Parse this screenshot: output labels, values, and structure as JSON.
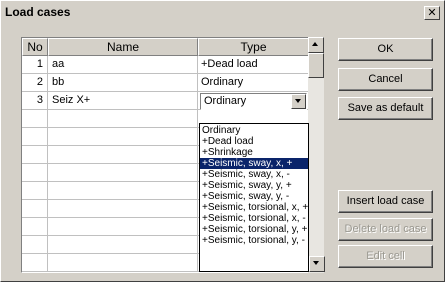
{
  "window": {
    "title": "Load cases",
    "close_glyph": "✕"
  },
  "grid": {
    "headers": {
      "no": "No",
      "name": "Name",
      "type": "Type"
    },
    "rows": [
      {
        "no": "1",
        "name": "aa",
        "type": "+Dead load"
      },
      {
        "no": "2",
        "name": "bb",
        "type": "Ordinary"
      },
      {
        "no": "3",
        "name": "Seiz X+",
        "type": "Ordinary"
      }
    ]
  },
  "type_combo": {
    "value": "Ordinary",
    "options": [
      "Ordinary",
      "+Dead load",
      "+Shrinkage",
      "+Seismic, sway, x, +",
      "+Seismic, sway, x, -",
      "+Seismic, sway, y, +",
      "+Seismic, sway, y, -",
      "+Seismic, torsional, x, +",
      "+Seismic, torsional, x, -",
      "+Seismic, torsional, y, +",
      "+Seismic, torsional, y, -"
    ],
    "highlighted": "+Seismic, sway, x, +"
  },
  "buttons": {
    "ok": "OK",
    "cancel": "Cancel",
    "save_default": "Save as default",
    "insert": "Insert load case",
    "delete": "Delete load case",
    "edit": "Edit cell"
  },
  "colors": {
    "face": "#d4d0c8",
    "highlight": "#0a246a",
    "disabled_text": "#9a9890"
  }
}
